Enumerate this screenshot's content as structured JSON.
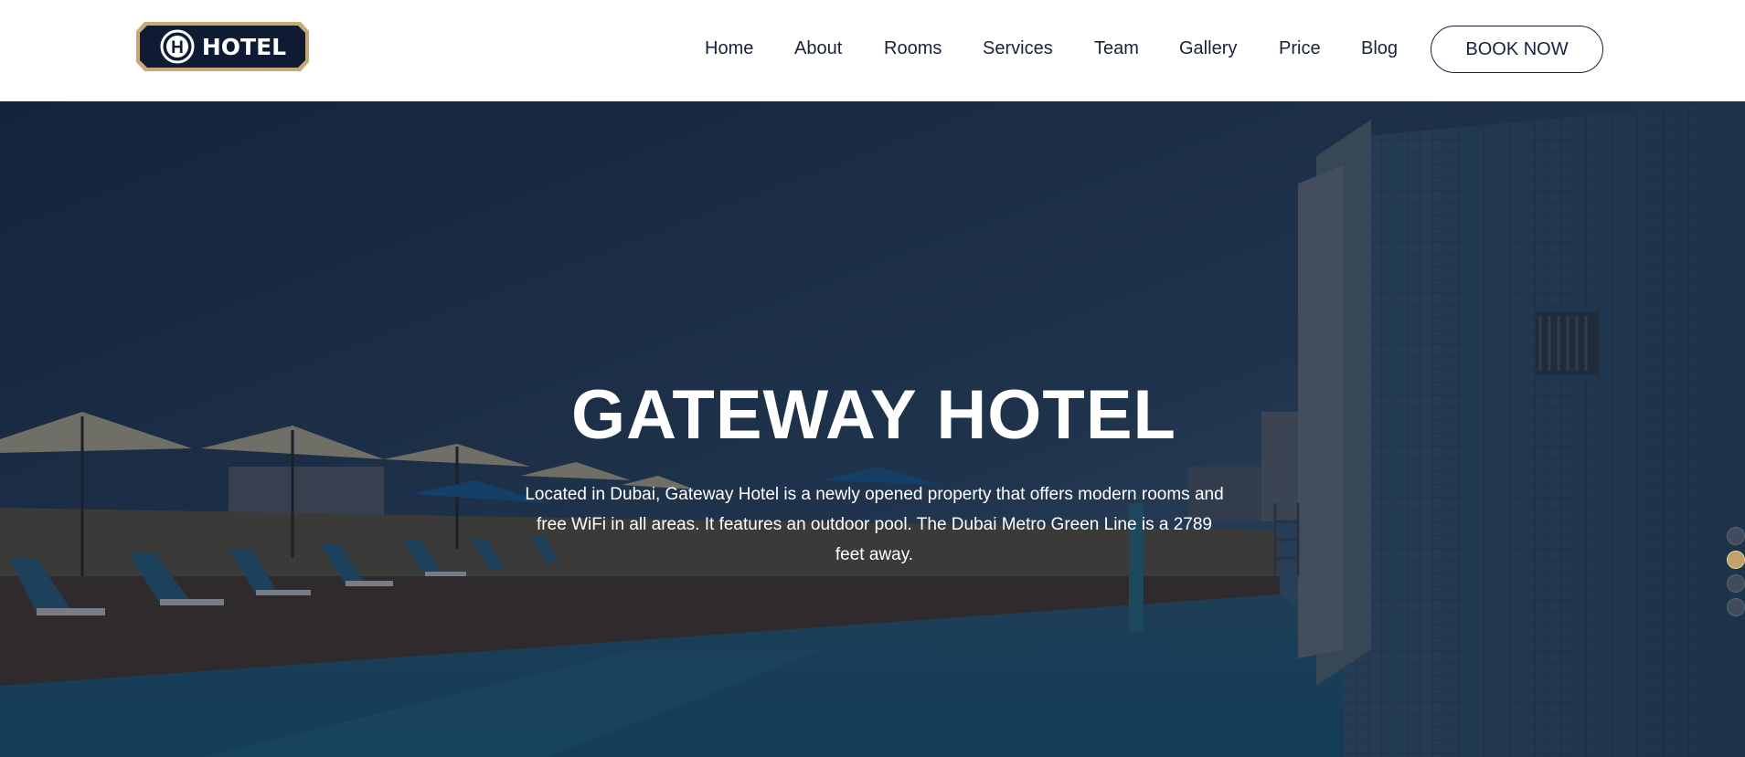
{
  "brand": {
    "logo_text": "HOTEL",
    "logo_letter": "H"
  },
  "nav": {
    "items": [
      {
        "label": "Home"
      },
      {
        "label": "About"
      },
      {
        "label": "Rooms"
      },
      {
        "label": "Services"
      },
      {
        "label": "Team"
      },
      {
        "label": "Gallery"
      },
      {
        "label": "Price"
      },
      {
        "label": "Blog"
      }
    ],
    "cta_label": "BOOK NOW"
  },
  "hero": {
    "title": "GATEWAY HOTEL",
    "description": "Located in Dubai, Gateway Hotel is a newly opened property that offers modern rooms and free WiFi in all areas. It features an outdoor pool. The Dubai Metro Green Line is a 2789 feet away.",
    "slides_total": 4,
    "active_slide": 2
  },
  "colors": {
    "navy": "#16223f",
    "gold": "#c4a06a",
    "nav_text": "#1a2238"
  }
}
